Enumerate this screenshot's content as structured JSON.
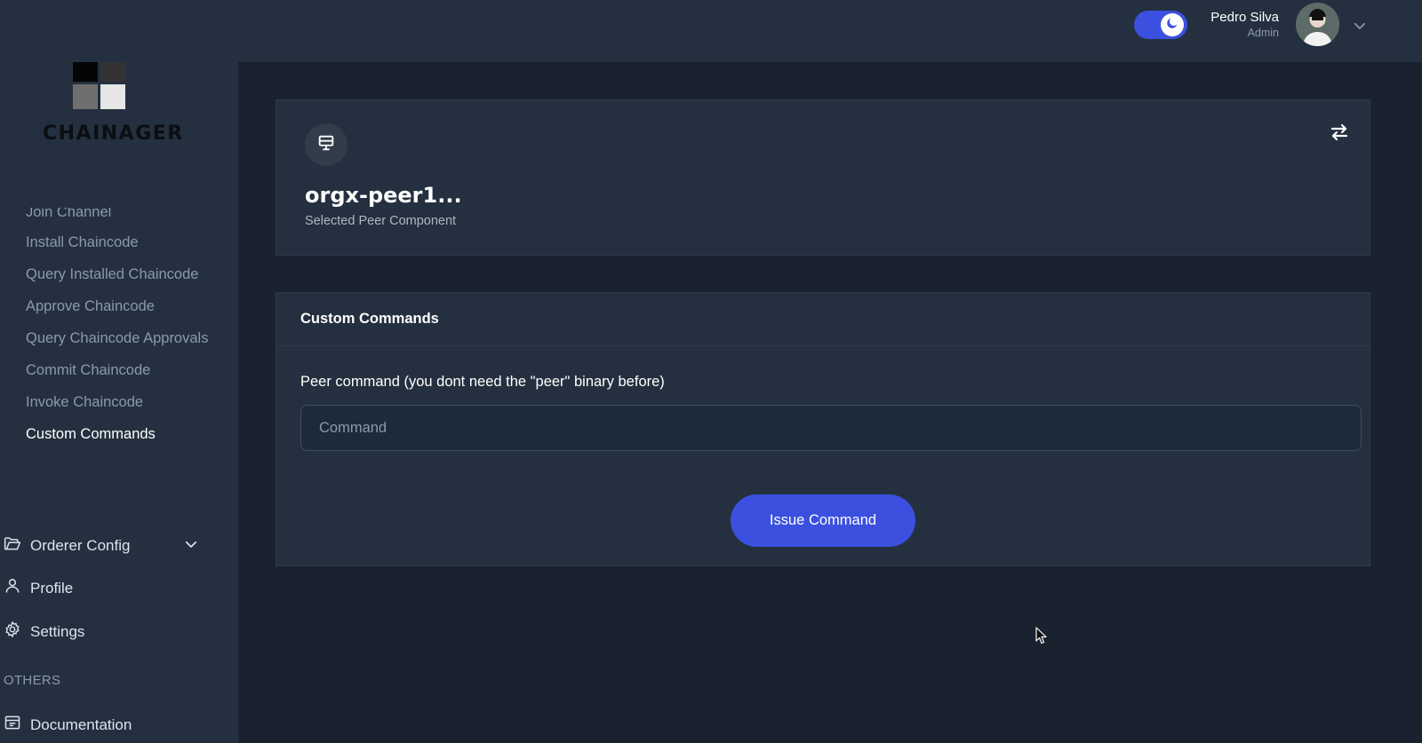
{
  "brand": {
    "name": "CHAINAGER"
  },
  "sidebar": {
    "submenu": [
      {
        "label": "Join Channel",
        "clipped": true
      },
      {
        "label": "Install Chaincode"
      },
      {
        "label": "Query Installed Chaincode"
      },
      {
        "label": "Approve Chaincode"
      },
      {
        "label": "Query Chaincode Approvals"
      },
      {
        "label": "Commit Chaincode"
      },
      {
        "label": "Invoke Chaincode"
      },
      {
        "label": "Custom Commands",
        "active": true
      }
    ],
    "orderer_config": "Orderer Config",
    "profile": "Profile",
    "settings": "Settings",
    "others_title": "OTHERS",
    "documentation": "Documentation"
  },
  "header": {
    "dark_mode": true,
    "user_name": "Pedro Silva",
    "user_role": "Admin"
  },
  "peer_card": {
    "title": "orgx-peer1...",
    "subtitle": "Selected Peer Component"
  },
  "commands_card": {
    "title": "Custom Commands",
    "field_label": "Peer command (you dont need the \"peer\" binary before)",
    "input_placeholder": "Command",
    "input_value": "",
    "button_label": "Issue Command"
  },
  "colors": {
    "accent": "#3c50e0",
    "sidebar_bg": "#24303f",
    "page_bg": "#1a222f"
  }
}
